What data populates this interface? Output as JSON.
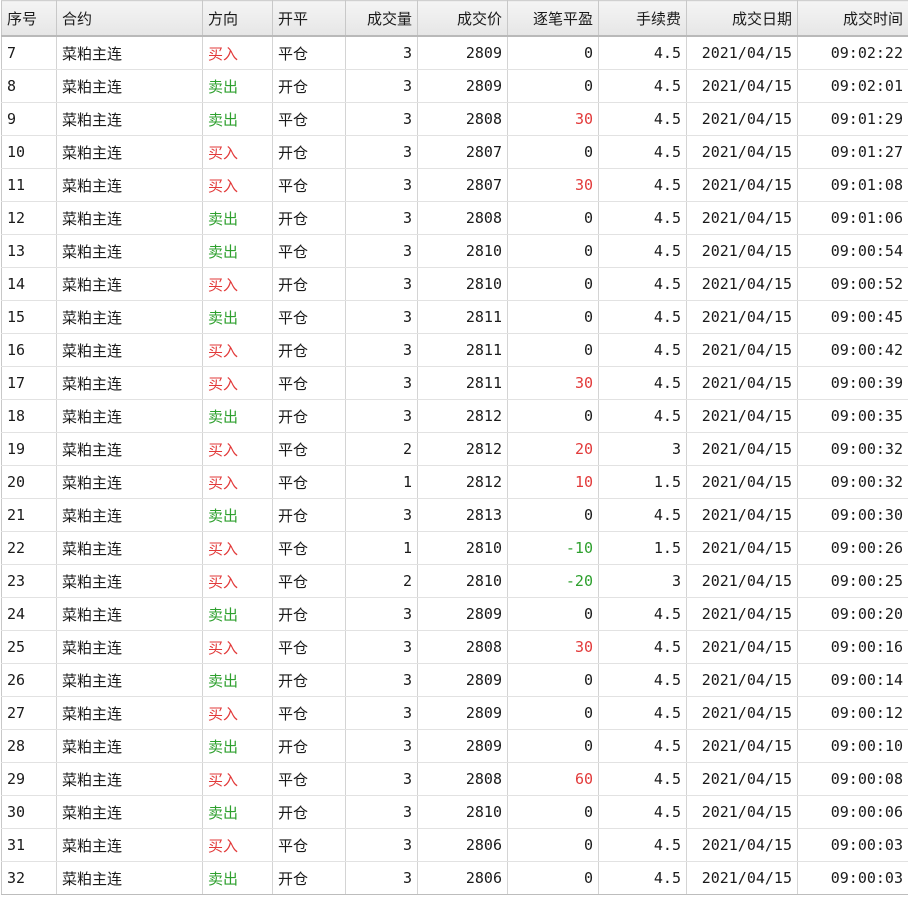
{
  "colors": {
    "buy": "#e23a3a",
    "sell": "#2ea02e",
    "profit_positive": "#e23a3a",
    "profit_negative": "#2ea02e"
  },
  "headers": [
    "序号",
    "合约",
    "方向",
    "开平",
    "成交量",
    "成交价",
    "逐笔平盈",
    "手续费",
    "成交日期",
    "成交时间"
  ],
  "rows": [
    {
      "id": "7",
      "contract": "菜粕主连",
      "direction": "买入",
      "offset": "平仓",
      "volume": "3",
      "price": "2809",
      "pnl": "0",
      "fee": "4.5",
      "date": "2021/04/15",
      "time": "09:02:22"
    },
    {
      "id": "8",
      "contract": "菜粕主连",
      "direction": "卖出",
      "offset": "开仓",
      "volume": "3",
      "price": "2809",
      "pnl": "0",
      "fee": "4.5",
      "date": "2021/04/15",
      "time": "09:02:01"
    },
    {
      "id": "9",
      "contract": "菜粕主连",
      "direction": "卖出",
      "offset": "平仓",
      "volume": "3",
      "price": "2808",
      "pnl": "30",
      "fee": "4.5",
      "date": "2021/04/15",
      "time": "09:01:29"
    },
    {
      "id": "10",
      "contract": "菜粕主连",
      "direction": "买入",
      "offset": "开仓",
      "volume": "3",
      "price": "2807",
      "pnl": "0",
      "fee": "4.5",
      "date": "2021/04/15",
      "time": "09:01:27"
    },
    {
      "id": "11",
      "contract": "菜粕主连",
      "direction": "买入",
      "offset": "平仓",
      "volume": "3",
      "price": "2807",
      "pnl": "30",
      "fee": "4.5",
      "date": "2021/04/15",
      "time": "09:01:08"
    },
    {
      "id": "12",
      "contract": "菜粕主连",
      "direction": "卖出",
      "offset": "开仓",
      "volume": "3",
      "price": "2808",
      "pnl": "0",
      "fee": "4.5",
      "date": "2021/04/15",
      "time": "09:01:06"
    },
    {
      "id": "13",
      "contract": "菜粕主连",
      "direction": "卖出",
      "offset": "平仓",
      "volume": "3",
      "price": "2810",
      "pnl": "0",
      "fee": "4.5",
      "date": "2021/04/15",
      "time": "09:00:54"
    },
    {
      "id": "14",
      "contract": "菜粕主连",
      "direction": "买入",
      "offset": "开仓",
      "volume": "3",
      "price": "2810",
      "pnl": "0",
      "fee": "4.5",
      "date": "2021/04/15",
      "time": "09:00:52"
    },
    {
      "id": "15",
      "contract": "菜粕主连",
      "direction": "卖出",
      "offset": "平仓",
      "volume": "3",
      "price": "2811",
      "pnl": "0",
      "fee": "4.5",
      "date": "2021/04/15",
      "time": "09:00:45"
    },
    {
      "id": "16",
      "contract": "菜粕主连",
      "direction": "买入",
      "offset": "开仓",
      "volume": "3",
      "price": "2811",
      "pnl": "0",
      "fee": "4.5",
      "date": "2021/04/15",
      "time": "09:00:42"
    },
    {
      "id": "17",
      "contract": "菜粕主连",
      "direction": "买入",
      "offset": "平仓",
      "volume": "3",
      "price": "2811",
      "pnl": "30",
      "fee": "4.5",
      "date": "2021/04/15",
      "time": "09:00:39"
    },
    {
      "id": "18",
      "contract": "菜粕主连",
      "direction": "卖出",
      "offset": "开仓",
      "volume": "3",
      "price": "2812",
      "pnl": "0",
      "fee": "4.5",
      "date": "2021/04/15",
      "time": "09:00:35"
    },
    {
      "id": "19",
      "contract": "菜粕主连",
      "direction": "买入",
      "offset": "平仓",
      "volume": "2",
      "price": "2812",
      "pnl": "20",
      "fee": "3",
      "date": "2021/04/15",
      "time": "09:00:32"
    },
    {
      "id": "20",
      "contract": "菜粕主连",
      "direction": "买入",
      "offset": "平仓",
      "volume": "1",
      "price": "2812",
      "pnl": "10",
      "fee": "1.5",
      "date": "2021/04/15",
      "time": "09:00:32"
    },
    {
      "id": "21",
      "contract": "菜粕主连",
      "direction": "卖出",
      "offset": "开仓",
      "volume": "3",
      "price": "2813",
      "pnl": "0",
      "fee": "4.5",
      "date": "2021/04/15",
      "time": "09:00:30"
    },
    {
      "id": "22",
      "contract": "菜粕主连",
      "direction": "买入",
      "offset": "平仓",
      "volume": "1",
      "price": "2810",
      "pnl": "-10",
      "fee": "1.5",
      "date": "2021/04/15",
      "time": "09:00:26"
    },
    {
      "id": "23",
      "contract": "菜粕主连",
      "direction": "买入",
      "offset": "平仓",
      "volume": "2",
      "price": "2810",
      "pnl": "-20",
      "fee": "3",
      "date": "2021/04/15",
      "time": "09:00:25"
    },
    {
      "id": "24",
      "contract": "菜粕主连",
      "direction": "卖出",
      "offset": "开仓",
      "volume": "3",
      "price": "2809",
      "pnl": "0",
      "fee": "4.5",
      "date": "2021/04/15",
      "time": "09:00:20"
    },
    {
      "id": "25",
      "contract": "菜粕主连",
      "direction": "买入",
      "offset": "平仓",
      "volume": "3",
      "price": "2808",
      "pnl": "30",
      "fee": "4.5",
      "date": "2021/04/15",
      "time": "09:00:16"
    },
    {
      "id": "26",
      "contract": "菜粕主连",
      "direction": "卖出",
      "offset": "开仓",
      "volume": "3",
      "price": "2809",
      "pnl": "0",
      "fee": "4.5",
      "date": "2021/04/15",
      "time": "09:00:14"
    },
    {
      "id": "27",
      "contract": "菜粕主连",
      "direction": "买入",
      "offset": "平仓",
      "volume": "3",
      "price": "2809",
      "pnl": "0",
      "fee": "4.5",
      "date": "2021/04/15",
      "time": "09:00:12"
    },
    {
      "id": "28",
      "contract": "菜粕主连",
      "direction": "卖出",
      "offset": "开仓",
      "volume": "3",
      "price": "2809",
      "pnl": "0",
      "fee": "4.5",
      "date": "2021/04/15",
      "time": "09:00:10"
    },
    {
      "id": "29",
      "contract": "菜粕主连",
      "direction": "买入",
      "offset": "平仓",
      "volume": "3",
      "price": "2808",
      "pnl": "60",
      "fee": "4.5",
      "date": "2021/04/15",
      "time": "09:00:08"
    },
    {
      "id": "30",
      "contract": "菜粕主连",
      "direction": "卖出",
      "offset": "开仓",
      "volume": "3",
      "price": "2810",
      "pnl": "0",
      "fee": "4.5",
      "date": "2021/04/15",
      "time": "09:00:06"
    },
    {
      "id": "31",
      "contract": "菜粕主连",
      "direction": "买入",
      "offset": "平仓",
      "volume": "3",
      "price": "2806",
      "pnl": "0",
      "fee": "4.5",
      "date": "2021/04/15",
      "time": "09:00:03"
    },
    {
      "id": "32",
      "contract": "菜粕主连",
      "direction": "卖出",
      "offset": "开仓",
      "volume": "3",
      "price": "2806",
      "pnl": "0",
      "fee": "4.5",
      "date": "2021/04/15",
      "time": "09:00:03"
    }
  ]
}
